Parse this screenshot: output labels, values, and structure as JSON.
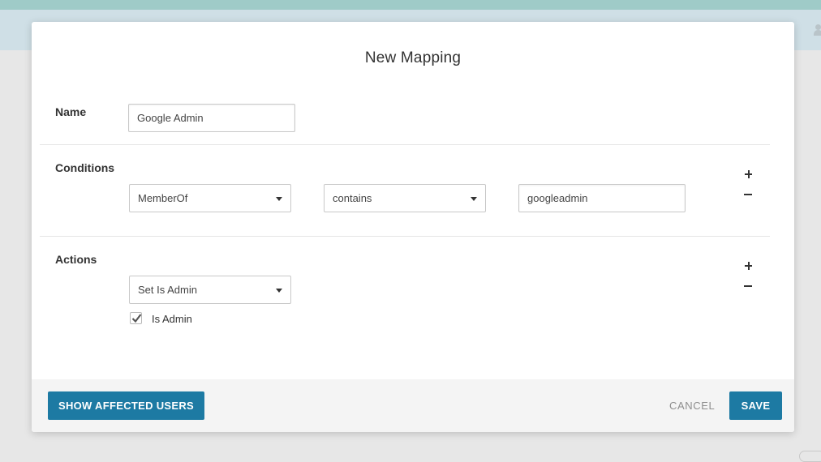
{
  "modal": {
    "title": "New Mapping"
  },
  "name_section": {
    "label": "Name",
    "value": "Google Admin"
  },
  "conditions": {
    "label": "Conditions",
    "attribute": "MemberOf",
    "operator": "contains",
    "value": "googleadmin",
    "add_icon": "plus-icon",
    "remove_icon": "minus-icon"
  },
  "actions": {
    "label": "Actions",
    "action": "Set Is Admin",
    "checkbox_label": "Is Admin",
    "checkbox_checked": true,
    "add_icon": "plus-icon",
    "remove_icon": "minus-icon"
  },
  "footer": {
    "show_affected_label": "SHOW AFFECTED USERS",
    "cancel_label": "CANCEL",
    "save_label": "SAVE"
  },
  "colors": {
    "primary": "#1d7aa3",
    "top_bar": "#9fcbc8",
    "sub_bar": "#cfdfe6",
    "footer_bg": "#f4f4f4"
  }
}
